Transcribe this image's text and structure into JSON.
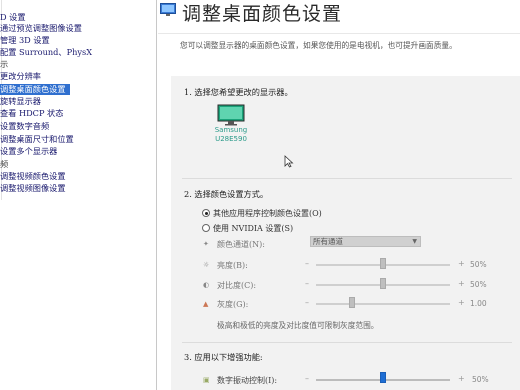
{
  "sidebar": {
    "items": [
      {
        "label": "D 设置",
        "kind": "item"
      },
      {
        "label": "通过预览调整图像设置",
        "kind": "item"
      },
      {
        "label": "管理 3D 设置",
        "kind": "item"
      },
      {
        "label": "配置 Surround、PhysX",
        "kind": "item"
      },
      {
        "label": "示",
        "kind": "cat"
      },
      {
        "label": "更改分辨率",
        "kind": "item"
      },
      {
        "label": "调整桌面颜色设置",
        "kind": "selected"
      },
      {
        "label": "旋转显示器",
        "kind": "item"
      },
      {
        "label": "查看 HDCP 状态",
        "kind": "item"
      },
      {
        "label": "设置数字音频",
        "kind": "item"
      },
      {
        "label": "调整桌面尺寸和位置",
        "kind": "item"
      },
      {
        "label": "设置多个显示器",
        "kind": "item"
      },
      {
        "label": "频",
        "kind": "cat"
      },
      {
        "label": "调整视频颜色设置",
        "kind": "item"
      },
      {
        "label": "调整视频图像设置",
        "kind": "item"
      }
    ]
  },
  "header": {
    "title": "调整桌面颜色设置",
    "description": "您可以调整显示器的桌面颜色设置，如果您使用的是电视机，也可提升画面质量。"
  },
  "step1": {
    "title": "1. 选择您希望更改的显示器。",
    "monitor_name_line1": "Samsung",
    "monitor_name_line2": "U28E590"
  },
  "step2": {
    "title": "2. 选择颜色设置方式。",
    "radio_other": "其他应用程序控制颜色设置(O)",
    "radio_nvidia": "使用 NVIDIA 设置(S)",
    "other_selected": true,
    "channel_label": "颜色通道(N):",
    "channel_value": "所有通道",
    "sliders": [
      {
        "label": "亮度(B):",
        "value": "50%",
        "level": 0.5,
        "icon": "brightness-icon"
      },
      {
        "label": "对比度(C):",
        "value": "50%",
        "level": 0.5,
        "icon": "contrast-icon"
      },
      {
        "label": "灰度(G):",
        "value": "1.00",
        "level": 0.27,
        "icon": "gamma-icon"
      }
    ],
    "note": "极高和极低的亮度及对比度值可限制灰度范围。"
  },
  "step3": {
    "title": "3. 应用以下增强功能:",
    "vibrance_label": "数字振动控制(I):",
    "vibrance_value": "50%",
    "vibrance_level": 0.5
  },
  "colors": {
    "selected_bg": "#2f6fcf",
    "link": "#1a1a6e",
    "accent": "#1f6ed4",
    "monitor_text": "#2b9b8a"
  }
}
